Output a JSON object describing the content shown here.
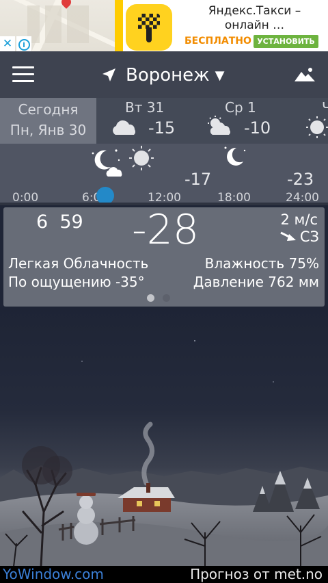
{
  "ad": {
    "title": "Яндекс.Такси – онлайн …",
    "free_label": "БЕСПЛАТНО",
    "install_label": "УСТАНОВИТЬ",
    "close_glyph": "✕",
    "info_glyph": "i"
  },
  "header": {
    "city": "Воронеж",
    "caret": "▼"
  },
  "forecast": {
    "today": {
      "name": "Сегодня",
      "date": "Пн, Янв 30"
    },
    "days": [
      {
        "name": "Вт 31",
        "temp": "-15",
        "icon": "cloud-icon"
      },
      {
        "name": "Ср 1",
        "temp": "-10",
        "icon": "cloud-sun-icon"
      },
      {
        "name": "Ч",
        "temp": "",
        "icon": "sun-icon"
      }
    ]
  },
  "hourly": {
    "temps": [
      "-17",
      "-23"
    ],
    "times": [
      "0:00",
      "6:00",
      "12:00",
      "18:00",
      "24:00"
    ],
    "icons": [
      "moon-cloud-icon",
      "sun-icon",
      "moon-icon"
    ]
  },
  "current": {
    "sunrise_hour": "6",
    "sunrise_min": "59",
    "temp": "-28",
    "wind_speed": "2 м/с",
    "wind_dir": "СЗ",
    "condition": "Легкая Облачность",
    "feels_like": "По ощущению -35°",
    "humidity": "Влажность 75%",
    "pressure": "Давление 762 мм",
    "page_count": 2,
    "active_page": 1
  },
  "footer": {
    "brand": "YoWindow.com",
    "credit": "Прогноз от met.no"
  },
  "colors": {
    "accent": "#2389c8",
    "header_bg": "#3e4350",
    "ad_free": "#f28c00",
    "ad_install": "#6db33f",
    "brand": "#3b7fd6"
  }
}
